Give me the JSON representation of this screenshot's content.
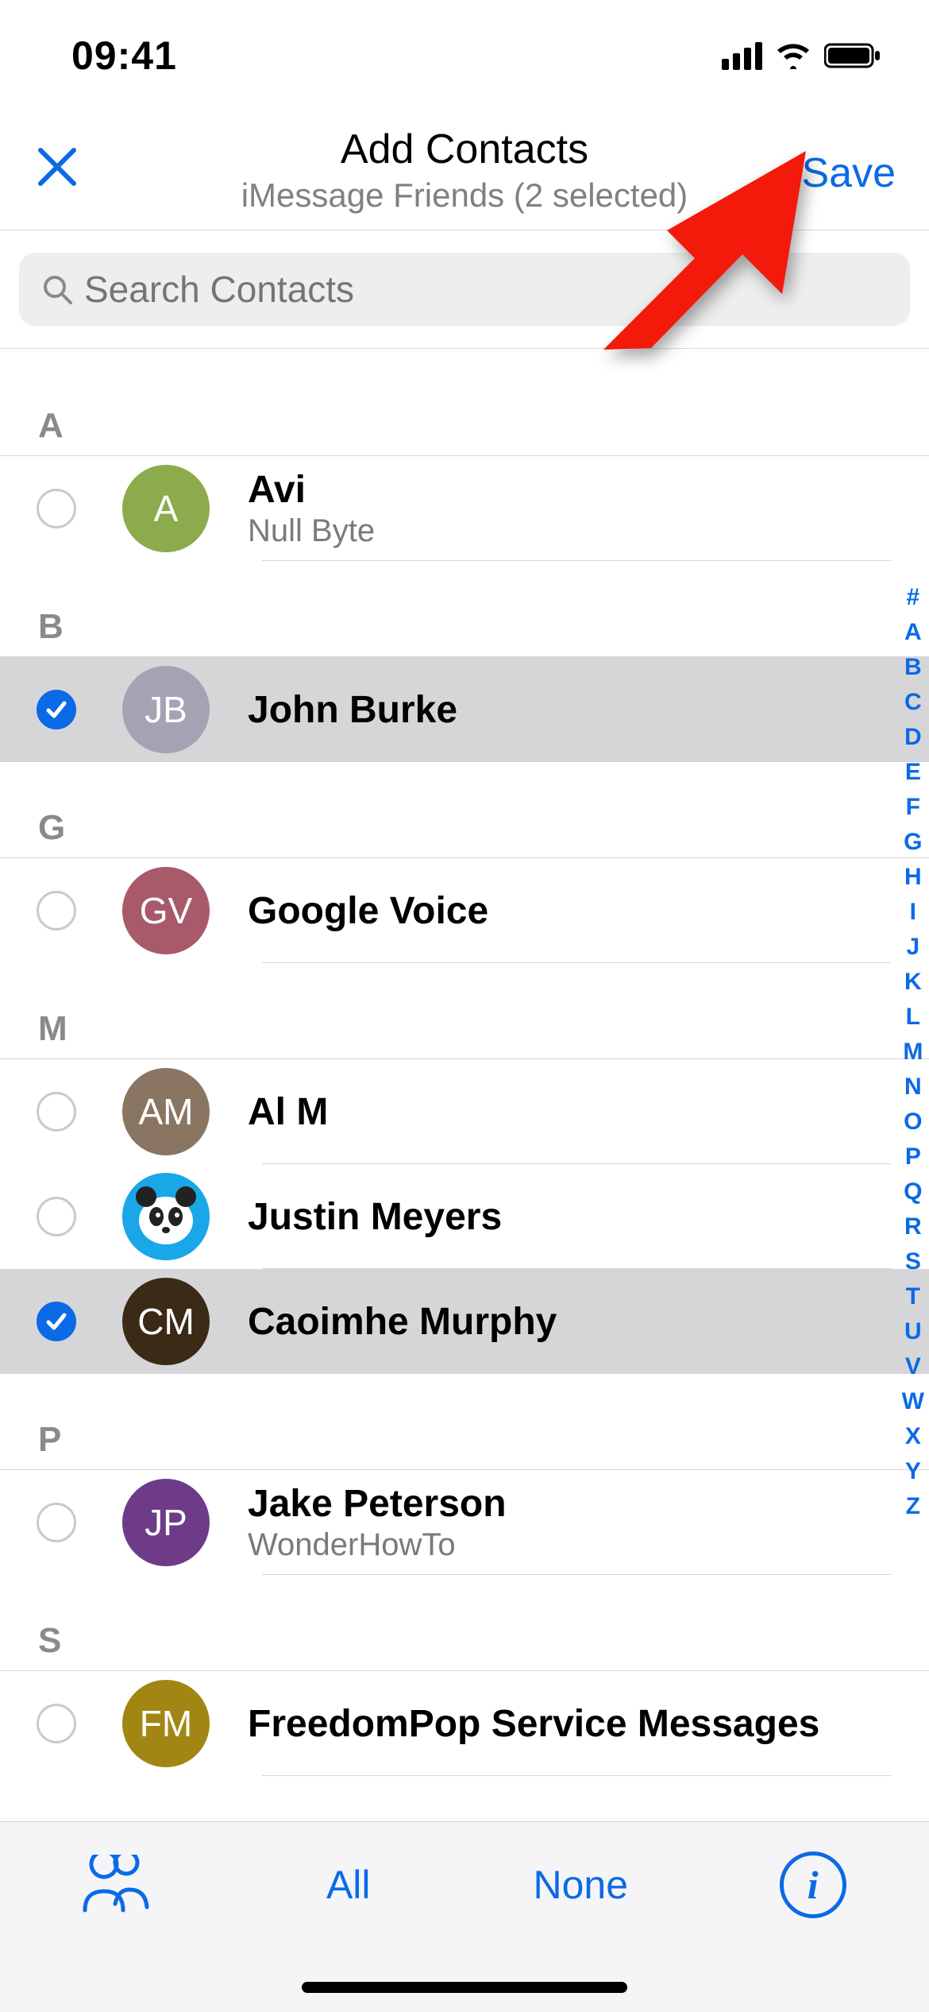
{
  "status": {
    "time": "09:41"
  },
  "header": {
    "title": "Add Contacts",
    "subtitle": "iMessage Friends (2 selected)",
    "save_label": "Save"
  },
  "search": {
    "placeholder": "Search Contacts"
  },
  "sections": [
    {
      "letter": "A",
      "rows": [
        {
          "name": "Avi",
          "sub": "Null Byte",
          "initials": "A",
          "color": "#8cab4c",
          "selected": false
        }
      ]
    },
    {
      "letter": "B",
      "rows": [
        {
          "name": "John Burke",
          "sub": "",
          "initials": "JB",
          "color": "#a6a2b4",
          "selected": true
        }
      ]
    },
    {
      "letter": "G",
      "rows": [
        {
          "name": "Google Voice",
          "sub": "",
          "initials": "GV",
          "color": "#a85a6b",
          "selected": false
        }
      ]
    },
    {
      "letter": "M",
      "rows": [
        {
          "name": "Al M",
          "sub": "",
          "initials": "AM",
          "color": "#8a7563",
          "selected": false
        },
        {
          "name": "Justin Meyers",
          "sub": "",
          "initials": "",
          "color": "panda",
          "selected": false
        },
        {
          "name": "Caoimhe Murphy",
          "sub": "",
          "initials": "CM",
          "color": "#3b2a16",
          "selected": true
        }
      ]
    },
    {
      "letter": "P",
      "rows": [
        {
          "name": "Jake Peterson",
          "sub": "WonderHowTo",
          "initials": "JP",
          "color": "#6d3b88",
          "selected": false
        }
      ]
    },
    {
      "letter": "S",
      "rows": [
        {
          "name": "FreedomPop Service Messages",
          "sub": "",
          "initials": "FM",
          "color": "#a28614",
          "selected": false
        }
      ]
    }
  ],
  "index_letters": [
    "#",
    "A",
    "B",
    "C",
    "D",
    "E",
    "F",
    "G",
    "H",
    "I",
    "J",
    "K",
    "L",
    "M",
    "N",
    "O",
    "P",
    "Q",
    "R",
    "S",
    "T",
    "U",
    "V",
    "W",
    "X",
    "Y",
    "Z"
  ],
  "toolbar": {
    "all_label": "All",
    "none_label": "None"
  }
}
